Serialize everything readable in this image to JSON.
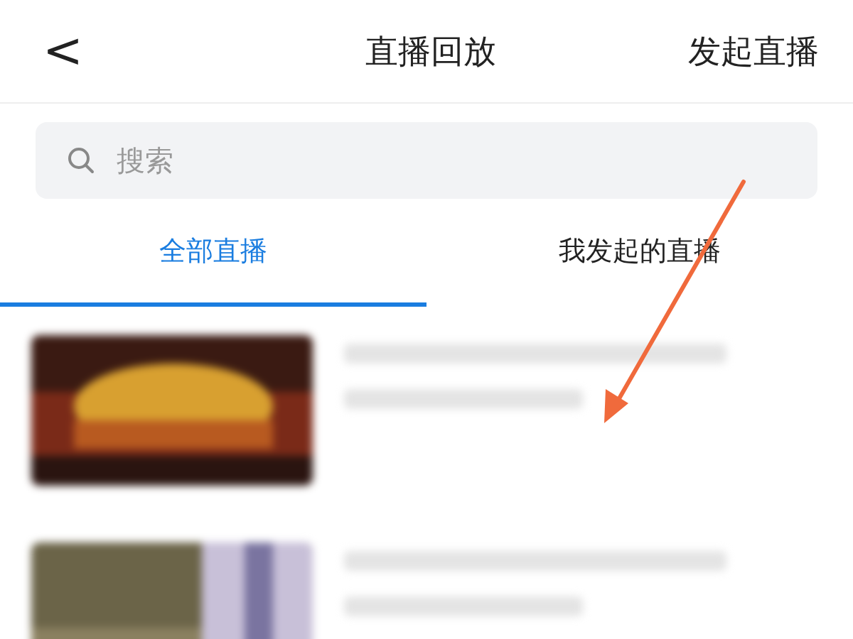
{
  "header": {
    "back": "<",
    "title": "直播回放",
    "action": "发起直播"
  },
  "search": {
    "placeholder": "搜索"
  },
  "tabs": [
    {
      "label": "全部直播",
      "selected": true
    },
    {
      "label": "我发起的直播",
      "selected": false
    }
  ]
}
